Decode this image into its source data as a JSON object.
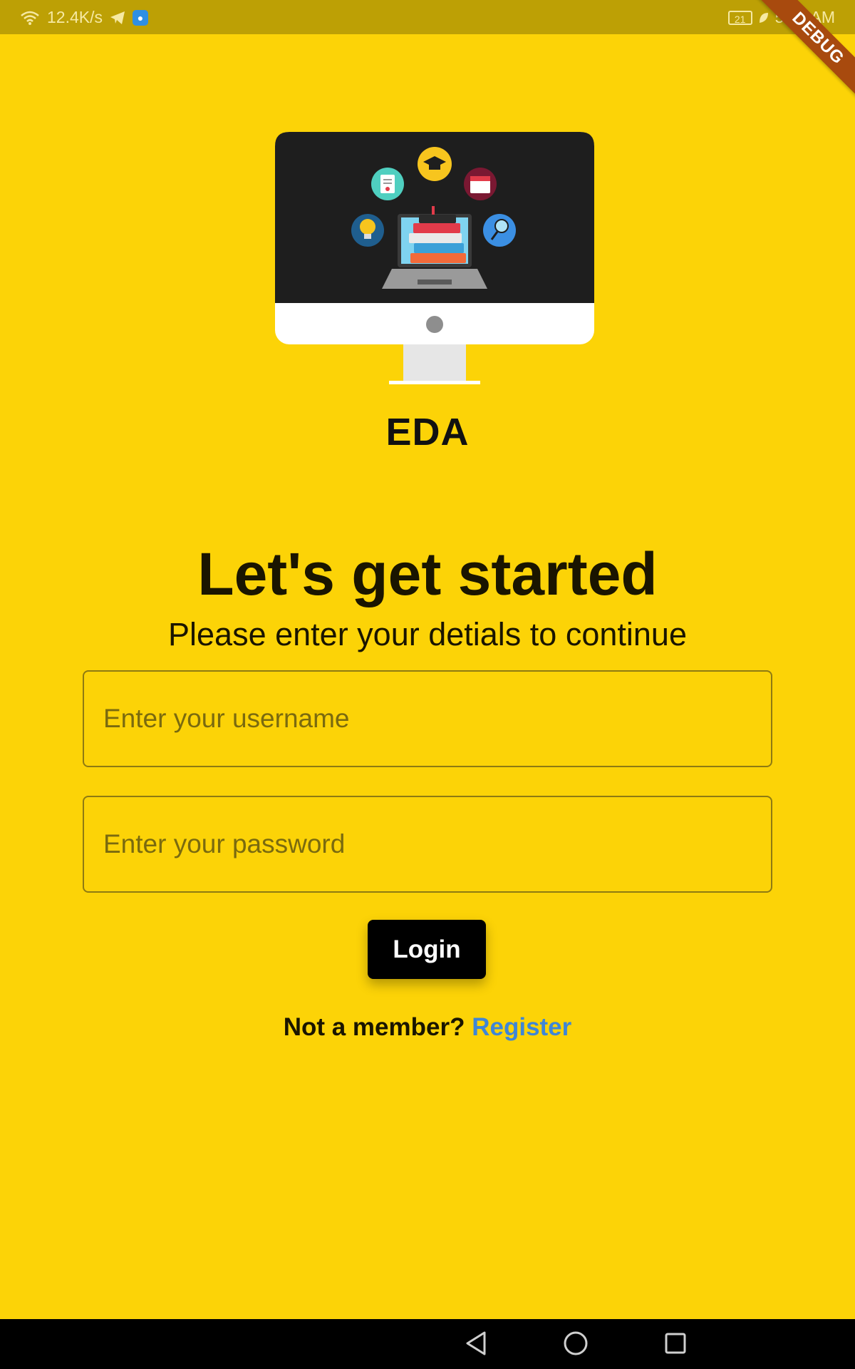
{
  "status_bar": {
    "network_speed": "12.4K/s",
    "battery_level": "21",
    "time": "5:31 AM"
  },
  "debug_banner": "DEBUG",
  "app": {
    "name": "EDA"
  },
  "login": {
    "headline": "Let's get started",
    "subtitle": "Please enter your detials to continue",
    "username_placeholder": "Enter your username",
    "password_placeholder": "Enter your password",
    "login_label": "Login",
    "register_prompt": "Not a member?",
    "register_label": "Register"
  },
  "colors": {
    "background": "#FCD307",
    "link": "#3F86D6",
    "button": "#000000"
  },
  "icons": [
    "wifi-icon",
    "telegram-icon",
    "app-notification-icon",
    "battery-icon",
    "leaf-icon",
    "back-icon",
    "home-icon",
    "recents-icon"
  ]
}
